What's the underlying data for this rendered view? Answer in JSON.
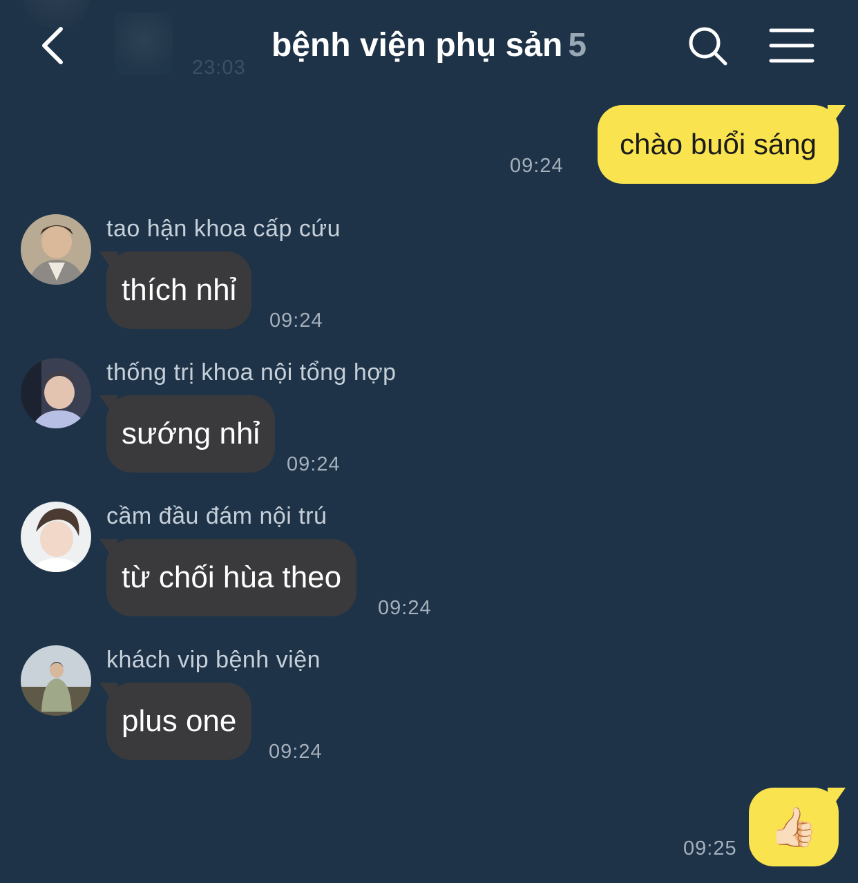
{
  "header": {
    "title": "bệnh viện phụ sản",
    "member_count": "5",
    "ghost_time": "23:03"
  },
  "messages": [
    {
      "type": "outgoing",
      "text": "chào buổi sáng",
      "time": "09:24"
    },
    {
      "type": "incoming",
      "sender": "tao hận khoa cấp cứu",
      "text": "thích nhỉ",
      "time": "09:24"
    },
    {
      "type": "incoming",
      "sender": "thống trị khoa nội tổng hợp",
      "text": "sướng nhỉ",
      "time": "09:24"
    },
    {
      "type": "incoming",
      "sender": "cầm đầu đám nội trú",
      "text": "từ chối hùa theo",
      "time": "09:24"
    },
    {
      "type": "incoming",
      "sender": "khách vip bệnh viện",
      "text": "plus one",
      "time": "09:24"
    },
    {
      "type": "outgoing",
      "text": "👍🏻",
      "time": "09:25"
    }
  ],
  "icons": {
    "back": "back-chevron-icon",
    "search": "search-icon",
    "menu": "hamburger-menu-icon"
  },
  "colors": {
    "background": "#1e3348",
    "outgoing_bubble": "#f9e34e",
    "incoming_bubble": "#3a3a3c",
    "timestamp": "#a5b0bb"
  }
}
